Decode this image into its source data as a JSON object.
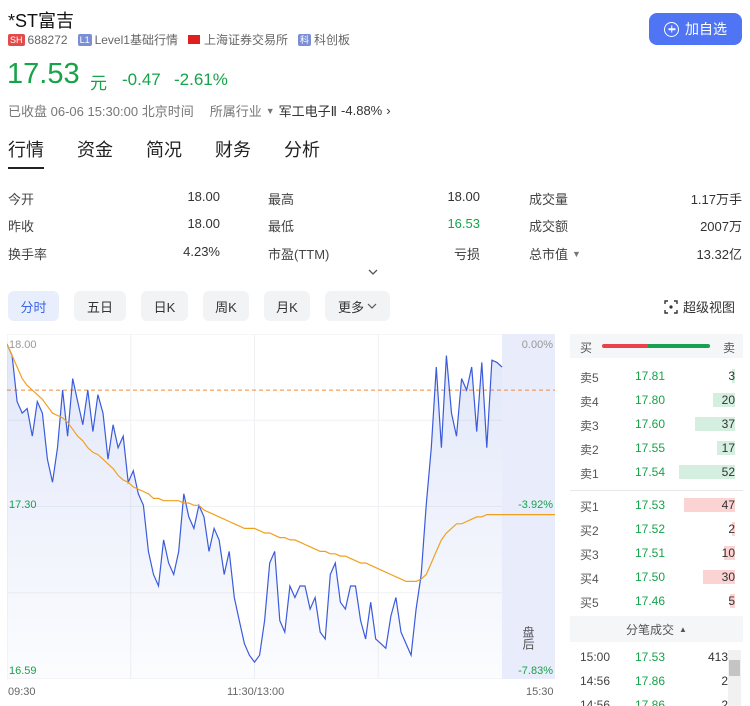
{
  "stock": {
    "name": "*ST富吉",
    "exchange_tag": "SH",
    "code": "688272",
    "level_tag": "L1",
    "level_label": "Level1基础行情",
    "exchange_label": "上海证券交易所",
    "board_tag": "科",
    "board_label": "科创板",
    "add_label": "加自选"
  },
  "quote": {
    "price": "17.53",
    "unit": "元",
    "change": "-0.47",
    "change_pct": "-2.61%",
    "status": "已收盘 06-06 15:30:00 北京时间",
    "industry_label": "所属行业",
    "industry_name": "军工电子Ⅱ",
    "industry_change": "-4.88%"
  },
  "tabs": [
    "行情",
    "资金",
    "简况",
    "财务",
    "分析"
  ],
  "stats": [
    {
      "label": "今开",
      "value": "18.00"
    },
    {
      "label": "最高",
      "value": "18.00"
    },
    {
      "label": "成交量",
      "value": "1.17万手"
    },
    {
      "label": "昨收",
      "value": "18.00"
    },
    {
      "label": "最低",
      "value": "16.53"
    },
    {
      "label": "成交额",
      "value": "2007万"
    },
    {
      "label": "换手率",
      "value": "4.23%"
    },
    {
      "label": "市盈(TTM)",
      "value": "亏损"
    },
    {
      "label": "总市值",
      "value": "13.32亿"
    }
  ],
  "periods": [
    "分时",
    "五日",
    "日K",
    "周K",
    "月K",
    "更多"
  ],
  "super_view": "超级视图",
  "chart_data": {
    "type": "line",
    "price_axis": [
      "18.00",
      "17.30",
      "16.59"
    ],
    "pct_axis": [
      "0.00%",
      "-3.92%",
      "-7.83%"
    ],
    "time_axis": [
      "09:30",
      "11:30/13:00",
      "15:30"
    ],
    "after_hours_label": "盘后",
    "prev_close": 17.8,
    "ylim": [
      16.59,
      18.0
    ],
    "series": [
      {
        "values": [
          18.0,
          17.95,
          17.75,
          17.7,
          17.72,
          17.6,
          17.75,
          17.7,
          17.5,
          17.4,
          17.55,
          17.8,
          17.6,
          17.85,
          17.75,
          17.65,
          17.8,
          17.62,
          17.78,
          17.7,
          17.5,
          17.65,
          17.55,
          17.6,
          17.4,
          17.45,
          17.35,
          17.3,
          17.1,
          17.0,
          16.95,
          17.15,
          17.05,
          17.0,
          17.1,
          17.35,
          17.25,
          17.2,
          17.3,
          17.25,
          17.1,
          17.2,
          17.15,
          17.0,
          17.1,
          16.9,
          16.8,
          16.7,
          16.65,
          16.62,
          16.65,
          16.8,
          17.05,
          17.1,
          16.8,
          16.75,
          16.95,
          16.9,
          16.95,
          16.95,
          16.85,
          16.9,
          16.75,
          16.72,
          17.0,
          17.05,
          16.88,
          16.85,
          16.95,
          16.95,
          16.8,
          16.72,
          16.88,
          16.72,
          16.7,
          16.68,
          16.82,
          16.9,
          16.75,
          16.7,
          16.65,
          16.85,
          17.0,
          17.3,
          17.55,
          17.9,
          17.55,
          17.95,
          17.7,
          17.6,
          17.85,
          17.8,
          17.9,
          17.62,
          17.92,
          17.55,
          17.93,
          17.92,
          17.9
        ]
      },
      {
        "values": [
          18.0,
          17.95,
          17.9,
          17.85,
          17.82,
          17.8,
          17.78,
          17.76,
          17.73,
          17.7,
          17.69,
          17.68,
          17.66,
          17.63,
          17.6,
          17.58,
          17.55,
          17.53,
          17.52,
          17.5,
          17.48,
          17.46,
          17.43,
          17.41,
          17.4,
          17.38,
          17.37,
          17.36,
          17.35,
          17.33,
          17.33,
          17.32,
          17.32,
          17.32,
          17.32,
          17.31,
          17.31,
          17.3,
          17.3,
          17.28,
          17.27,
          17.26,
          17.25,
          17.24,
          17.23,
          17.22,
          17.21,
          17.2,
          17.2,
          17.2,
          17.19,
          17.18,
          17.18,
          17.17,
          17.16,
          17.16,
          17.15,
          17.15,
          17.14,
          17.13,
          17.12,
          17.11,
          17.1,
          17.1,
          17.09,
          17.09,
          17.08,
          17.08,
          17.07,
          17.06,
          17.05,
          17.05,
          17.04,
          17.03,
          17.02,
          17.01,
          17.0,
          16.99,
          16.98,
          16.97,
          16.97,
          16.97,
          16.98,
          17.0,
          17.05,
          17.1,
          17.15,
          17.18,
          17.2,
          17.22,
          17.22,
          17.23,
          17.24,
          17.25,
          17.25,
          17.26,
          17.26,
          17.26,
          17.26
        ]
      }
    ]
  },
  "book": {
    "buy_label": "买",
    "sell_label": "卖",
    "asks": [
      {
        "label": "卖5",
        "price": "17.81",
        "vol": "3"
      },
      {
        "label": "卖4",
        "price": "17.80",
        "vol": "20"
      },
      {
        "label": "卖3",
        "price": "17.60",
        "vol": "37"
      },
      {
        "label": "卖2",
        "price": "17.55",
        "vol": "17"
      },
      {
        "label": "卖1",
        "price": "17.54",
        "vol": "52"
      }
    ],
    "bids": [
      {
        "label": "买1",
        "price": "17.53",
        "vol": "47"
      },
      {
        "label": "买2",
        "price": "17.52",
        "vol": "2"
      },
      {
        "label": "买3",
        "price": "17.51",
        "vol": "10"
      },
      {
        "label": "买4",
        "price": "17.50",
        "vol": "30"
      },
      {
        "label": "买5",
        "price": "17.46",
        "vol": "5"
      }
    ],
    "trades_label": "分笔成交",
    "trades": [
      {
        "time": "15:00",
        "price": "17.53",
        "vol": "413"
      },
      {
        "time": "14:56",
        "price": "17.86",
        "vol": "2"
      },
      {
        "time": "14:56",
        "price": "17.86",
        "vol": "2"
      }
    ]
  },
  "colors": {
    "up": "#e24b4b",
    "down": "#16a34a",
    "price_line": "#3b5bdb",
    "avg_line": "#f0a020",
    "accent": "#4f75f5"
  }
}
